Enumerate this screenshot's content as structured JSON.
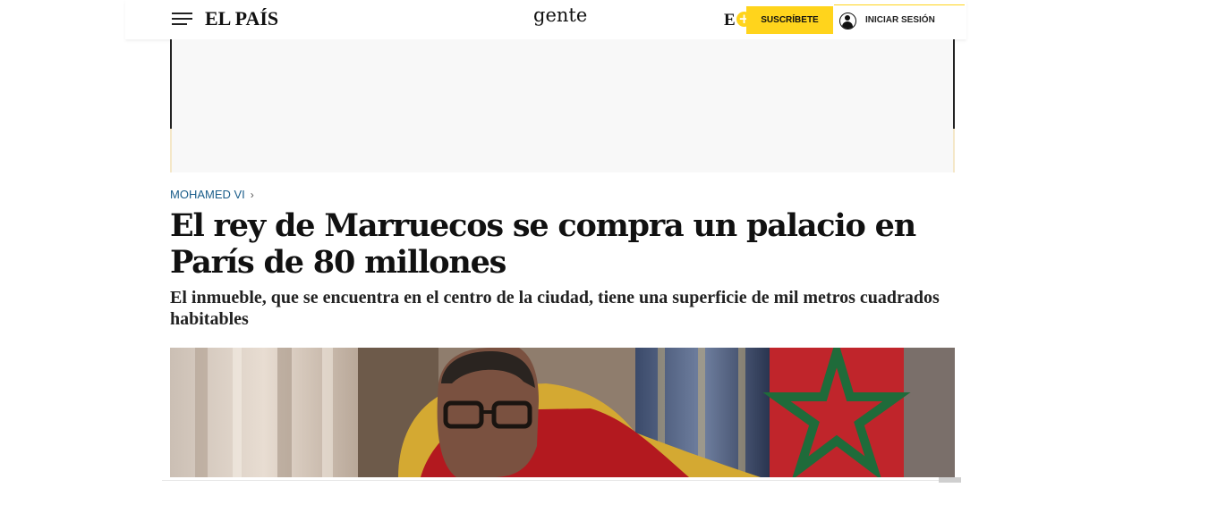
{
  "header": {
    "logo": "EL PAÍS",
    "section": "gente",
    "e_plus_letter": "E",
    "e_plus_symbol": "+",
    "subscribe_label": "SUSCRÍBETE",
    "login_label": "INICIAR SESIÓN",
    "accent_color": "#ffd41c"
  },
  "article": {
    "kicker": "MOHAMED VI",
    "kicker_icon": "chevron-right-icon",
    "headline": "El rey de Marruecos se compra un palacio en París de 80 millones",
    "subheadline": "El inmueble, que se encuentra en el centro de la ciudad, tiene una superficie de mil metros cuadrados habitables",
    "kicker_color": "#1a5d8a"
  },
  "icons": {
    "menu": "hamburger-menu-icon",
    "user": "user-icon"
  }
}
